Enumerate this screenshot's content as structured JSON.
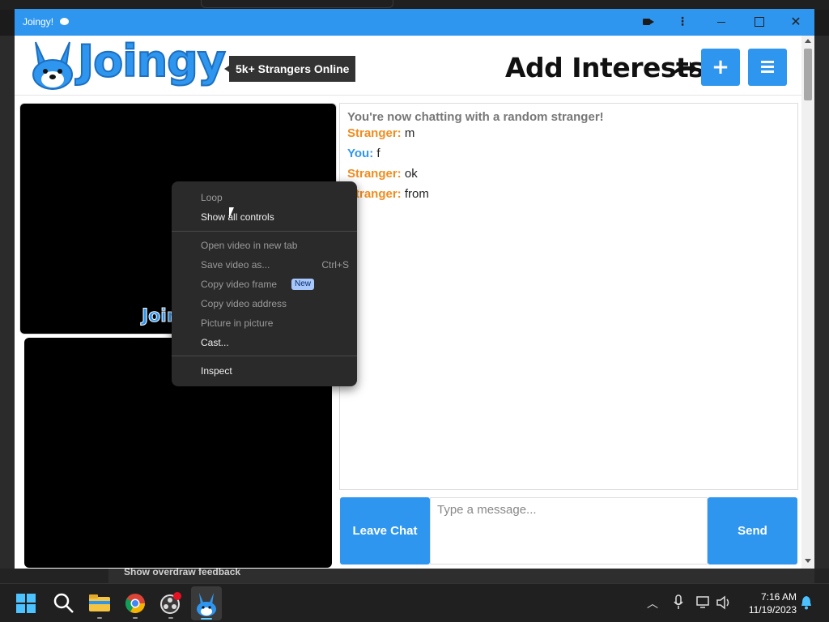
{
  "window": {
    "title": "Joingy!"
  },
  "header": {
    "logo_text": "Joingy",
    "online_badge": "5k+ Strangers Online",
    "add_interests": "Add Interests",
    "plus_label": "+"
  },
  "video": {
    "watermark": "Join"
  },
  "chat": {
    "intro": "You're now chatting with a random stranger!",
    "messages": [
      {
        "who": "Stranger:",
        "text": "m"
      },
      {
        "who": "You:",
        "text": "f"
      },
      {
        "who": "Stranger:",
        "text": "ok"
      },
      {
        "who": "Stranger:",
        "text": "from"
      }
    ],
    "leave_label": "Leave Chat",
    "input_placeholder": "Type a message...",
    "send_label": "Send"
  },
  "context_menu": {
    "items": [
      {
        "label": "Loop",
        "enabled": false
      },
      {
        "label": "Show all controls",
        "enabled": true
      },
      {
        "label": "Open video in new tab",
        "enabled": false
      },
      {
        "label": "Save video as...",
        "enabled": false,
        "shortcut": "Ctrl+S"
      },
      {
        "label": "Copy video frame",
        "enabled": false,
        "badge": "New"
      },
      {
        "label": "Copy video address",
        "enabled": false
      },
      {
        "label": "Picture in picture",
        "enabled": false
      },
      {
        "label": "Cast...",
        "enabled": true
      },
      {
        "label": "Inspect",
        "enabled": true
      }
    ]
  },
  "background": {
    "overdraw_text": "Show overdraw feedback"
  },
  "taskbar": {
    "time": "7:16 AM",
    "date": "11/19/2023"
  },
  "colors": {
    "brand_blue": "#2f96f0",
    "stranger_orange": "#f08c1e"
  }
}
